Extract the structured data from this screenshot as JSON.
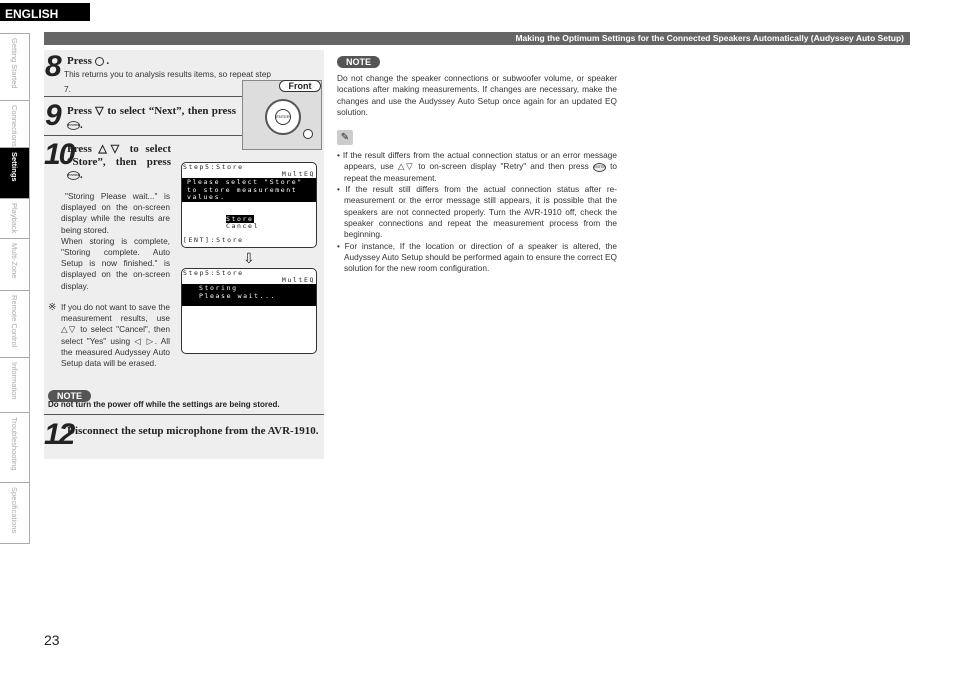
{
  "header": {
    "language": "ENGLISH",
    "section_title": "Making the Optimum Settings for the Connected Speakers Automatically (Audyssey Auto Setup)"
  },
  "side_tabs": [
    {
      "label": "Getting Started"
    },
    {
      "label": "Connections"
    },
    {
      "label": "Settings",
      "active": true
    },
    {
      "label": "Playback"
    },
    {
      "label": "Multi-Zone"
    },
    {
      "label": "Remote Control"
    },
    {
      "label": "Information"
    },
    {
      "label": "Troubleshooting"
    },
    {
      "label": "Specifications"
    }
  ],
  "page_number": "23",
  "steps": {
    "s8": {
      "num": "8",
      "text": "Press",
      "button": "RETURN",
      "desc": "This returns you to analysis results items, so repeat step 7."
    },
    "s9": {
      "num": "9",
      "text": "Press ▽ to select “Next”, then press"
    },
    "s10": {
      "num": "10",
      "text": "Press △▽ to select “Store”, then press",
      "desc1": "\"Storing Please wait...\" is displayed on the on-screen display while the results are being stored.",
      "desc2": "When storing is complete, \"Storing complete. Auto Setup is now finished.\" is displayed on the on-screen display.",
      "asterisk": "※",
      "note": "If you do not want to save the measurement results, use △▽ to select \"Cancel\", then select \"Yes\" using ◁ ▷. All the measured Audyssey Auto Setup data will be erased."
    },
    "note_label": "NOTE",
    "note_text": "Do not turn the power off while the settings are being stored.",
    "s12": {
      "num": "12",
      "text": "Disconnect the setup microphone from the AVR-1910."
    }
  },
  "remote": {
    "label": "Front",
    "enter": "ENTER",
    "return": "RETURN"
  },
  "screen1": {
    "title": "Step5:Store",
    "sub": "MultEQ",
    "msg": [
      "Please select \"Store\"",
      "to store measurement",
      "values."
    ],
    "opt1": "Store",
    "opt2": "Cancel",
    "footer": "[ENT]:Store"
  },
  "arrow": "⇩",
  "screen2": {
    "title": "Step5:Store",
    "sub": "MultEQ",
    "msg": [
      "Storing",
      "Please wait..."
    ]
  },
  "right": {
    "note_label": "NOTE",
    "note_text": "Do not change the speaker connections or subwoofer volume, or speaker locations after making measurements. If changes are necessary, make the changes and use the Audyssey Auto Setup once again for an updated EQ solution.",
    "bullets": [
      "If the result differs from the actual connection status or an error message appears, use △▽ to on-screen display \"Retry\" and then press",
      "to repeat the measurement.",
      "If the result still differs from the actual connection status after re-measurement or the error message still appears, it is possible that the speakers are not connected properly. Turn the AVR-1910 off, check the speaker connections and repeat the measurement process from the beginning.",
      "For instance, If the location or direction of a speaker is altered, the Audyssey Auto Setup should be performed again to ensure the correct EQ solution for the new room configuration."
    ],
    "enter_icon": "ENTER"
  }
}
